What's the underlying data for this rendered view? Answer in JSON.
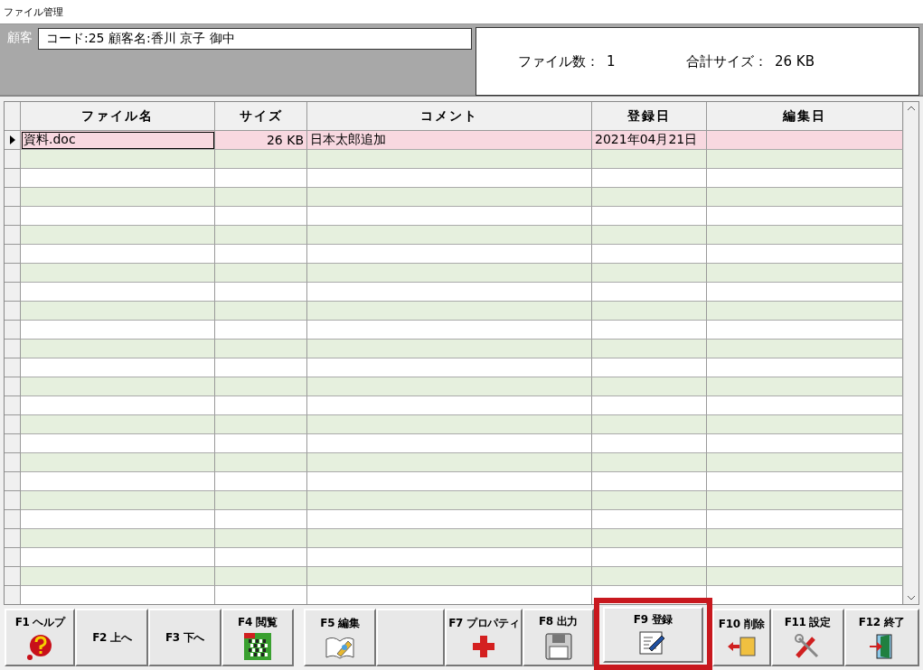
{
  "window": {
    "title": "ファイル管理"
  },
  "customer": {
    "label": "顧客",
    "value": "コード:25  顧客名:香川 京子 御中"
  },
  "summary": {
    "file_count_label": "ファイル数：",
    "file_count": "1",
    "total_size_label": "合計サイズ：",
    "total_size": "26 KB"
  },
  "table": {
    "columns": [
      "ファイル名",
      "サイズ",
      "コメント",
      "登録日",
      "編集日"
    ],
    "rows": [
      {
        "selected": true,
        "cells": [
          "資料.doc",
          "26 KB",
          "日本太郎追加",
          "2021年04月21日",
          ""
        ]
      }
    ]
  },
  "buttons": [
    {
      "label": "F1 ヘルプ",
      "kind": "help",
      "highlighted": false
    },
    {
      "label": "F2 上へ",
      "kind": "text",
      "highlighted": false
    },
    {
      "label": "F3 下へ",
      "kind": "text",
      "highlighted": false
    },
    {
      "label": "F4 閲覧",
      "kind": "view",
      "highlighted": false
    },
    {
      "label": "F5 編集",
      "kind": "edit",
      "highlighted": false
    },
    {
      "kind": "blank",
      "highlighted": false
    },
    {
      "label": "F7 プロパティ",
      "kind": "property",
      "highlighted": false
    },
    {
      "label": "F8 出力",
      "kind": "output",
      "highlighted": false
    },
    {
      "label": "F9 登録",
      "kind": "register",
      "highlighted": true
    },
    {
      "label": "F10 削除",
      "kind": "delete",
      "highlighted": false
    },
    {
      "label": "F11 設定",
      "kind": "settings",
      "highlighted": false
    },
    {
      "label": "F12 終了",
      "kind": "exit",
      "highlighted": false
    }
  ]
}
